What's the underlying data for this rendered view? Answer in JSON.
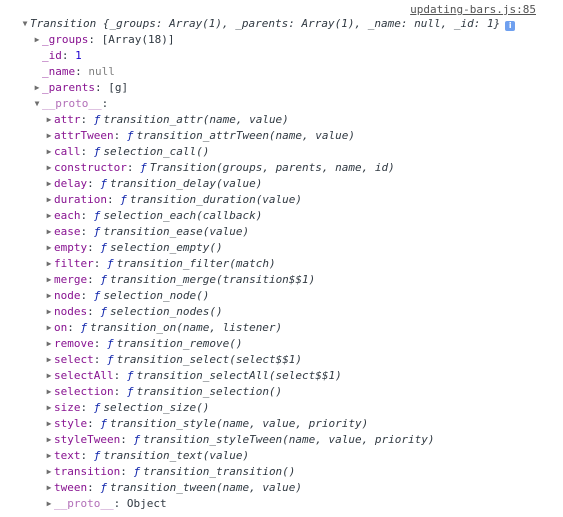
{
  "source_link": "updating-bars.js:85",
  "header": {
    "summary": "Transition {_groups: Array(1), _parents: Array(1), _name: null, _id: 1}",
    "info_icon": "info-icon"
  },
  "own_props": [
    {
      "key": "_groups",
      "value": "[Array(18)]",
      "expandable": true,
      "kind": "obj"
    },
    {
      "key": "_id",
      "value": "1",
      "expandable": false,
      "kind": "num"
    },
    {
      "key": "_name",
      "value": "null",
      "expandable": false,
      "kind": "nul"
    },
    {
      "key": "_parents",
      "value": "[g]",
      "expandable": true,
      "kind": "obj"
    }
  ],
  "proto": {
    "key": "__proto__",
    "colon": ":"
  },
  "methods": [
    {
      "key": "attr",
      "sig": "transition_attr(name, value)"
    },
    {
      "key": "attrTween",
      "sig": "transition_attrTween(name, value)"
    },
    {
      "key": "call",
      "sig": "selection_call()"
    },
    {
      "key": "constructor",
      "sig": "Transition(groups, parents, name, id)"
    },
    {
      "key": "delay",
      "sig": "transition_delay(value)"
    },
    {
      "key": "duration",
      "sig": "transition_duration(value)"
    },
    {
      "key": "each",
      "sig": "selection_each(callback)"
    },
    {
      "key": "ease",
      "sig": "transition_ease(value)"
    },
    {
      "key": "empty",
      "sig": "selection_empty()"
    },
    {
      "key": "filter",
      "sig": "transition_filter(match)"
    },
    {
      "key": "merge",
      "sig": "transition_merge(transition$$1)"
    },
    {
      "key": "node",
      "sig": "selection_node()"
    },
    {
      "key": "nodes",
      "sig": "selection_nodes()"
    },
    {
      "key": "on",
      "sig": "transition_on(name, listener)"
    },
    {
      "key": "remove",
      "sig": "transition_remove()"
    },
    {
      "key": "select",
      "sig": "transition_select(select$$1)"
    },
    {
      "key": "selectAll",
      "sig": "transition_selectAll(select$$1)"
    },
    {
      "key": "selection",
      "sig": "transition_selection()"
    },
    {
      "key": "size",
      "sig": "selection_size()"
    },
    {
      "key": "style",
      "sig": "transition_style(name, value, priority)"
    },
    {
      "key": "styleTween",
      "sig": "transition_styleTween(name, value, priority)"
    },
    {
      "key": "text",
      "sig": "transition_text(value)"
    },
    {
      "key": "transition",
      "sig": "transition_transition()"
    },
    {
      "key": "tween",
      "sig": "transition_tween(name, value)"
    }
  ],
  "func_marker": "ƒ",
  "proto_tail": {
    "key": "__proto__",
    "value": "Object"
  }
}
